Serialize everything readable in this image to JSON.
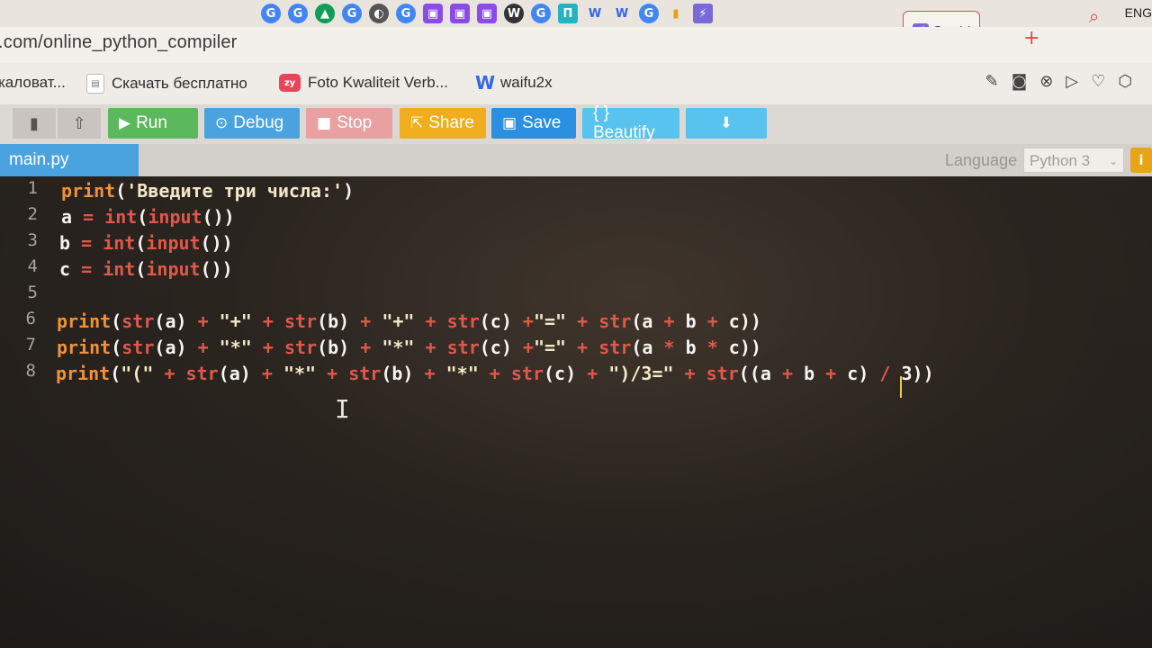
{
  "browser": {
    "url": ".com/online_python_compiler",
    "active_tab_title": "Or",
    "tab_icons": [
      "google-icon",
      "google-icon",
      "google-drive-icon",
      "google-icon",
      "generic-icon",
      "google-icon",
      "twitch-icon",
      "twitch-icon",
      "twitch-icon",
      "wordpress-icon",
      "google-icon",
      "pi-icon",
      "w-icon",
      "w-icon",
      "google-icon",
      "chart-icon",
      "bolt-icon"
    ],
    "new_tab": "+",
    "lang_indicator": "ENG",
    "bookmarks": [
      {
        "label": "каловат...",
        "icon": ""
      },
      {
        "label": "Скачать бесплатно",
        "icon": "doc"
      },
      {
        "label": "Foto Kwaliteit Verb...",
        "icon": "zyro"
      },
      {
        "label": "waifu2x",
        "icon": "W"
      }
    ]
  },
  "toolbar": {
    "run": "Run",
    "debug": "Debug",
    "stop": "Stop",
    "share": "Share",
    "save": "Save",
    "beautify": "{ } Beautify",
    "colors": {
      "run": "#5cb85c",
      "debug": "#4aa3df",
      "stop": "#e8a0a0",
      "share": "#f0ad1e",
      "save": "#2a8fe0",
      "beautify": "#58c3ee",
      "download": "#58c3ee"
    }
  },
  "filebar": {
    "file_tab": "main.py",
    "language_label": "Language",
    "language_value": "Python 3",
    "info": "i"
  },
  "editor": {
    "line_numbers": [
      "1",
      "2",
      "3",
      "4",
      "5",
      "6",
      "7",
      "8"
    ],
    "lines": [
      "print('Введите три числа:')",
      "a = int(input())",
      "b = int(input())",
      "c = int(input())",
      "",
      "print(str(a) + \"+\" + str(b) + \"+\" + str(c) +\"=\" + str(a + b + c))",
      "print(str(a) + \"*\" + str(b) + \"*\" + str(c) +\"=\" + str(a * b * c))",
      "print(\"(\" + str(a) + \"*\" + str(b) + \"*\" + str(c) + \")/3=\" + str((a + b + c) / 3))"
    ]
  }
}
